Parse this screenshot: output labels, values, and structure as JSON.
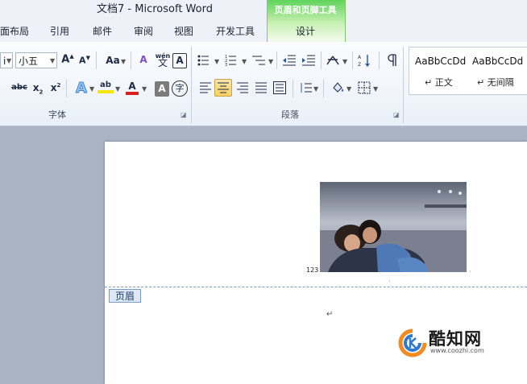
{
  "window": {
    "title": "文档7 - Microsoft Word"
  },
  "contextual_tab": {
    "group_title": "页眉和页脚工具",
    "tab_label": "设计",
    "color": "#5fd35a"
  },
  "ribbon_tabs": [
    "面布局",
    "引用",
    "邮件",
    "审阅",
    "视图",
    "开发工具"
  ],
  "font_group": {
    "font_name_partial": "i",
    "font_size": "小五",
    "grow_label": "A",
    "shrink_label": "A",
    "change_case_label": "Aa",
    "clear_format_label": "A",
    "phonetic_top": "wén",
    "phonetic_char": "文",
    "char_border_label": "A",
    "strike_label": "abc",
    "sub_label": "x",
    "sup_label": "x",
    "effects_label": "A",
    "highlight_label": "ab",
    "font_color_label": "A",
    "shading_label": "A",
    "enclose_label": "字",
    "label": "字体",
    "font_color": "#d62020",
    "highlight_color": "#f7e700"
  },
  "paragraph_group": {
    "label": "段落"
  },
  "styles_gallery": {
    "items": [
      {
        "sample": "AaBbCcDd",
        "name": "↵ 正文"
      },
      {
        "sample": "AaBbCcDd",
        "name": "↵ 无间隔"
      }
    ]
  },
  "document": {
    "header_number": "123",
    "header_tag": "页眉",
    "paragraph_mark": "↵",
    "small_mark": "·"
  },
  "watermark": {
    "name": "酷知网",
    "url": "www.coozhi.com"
  }
}
